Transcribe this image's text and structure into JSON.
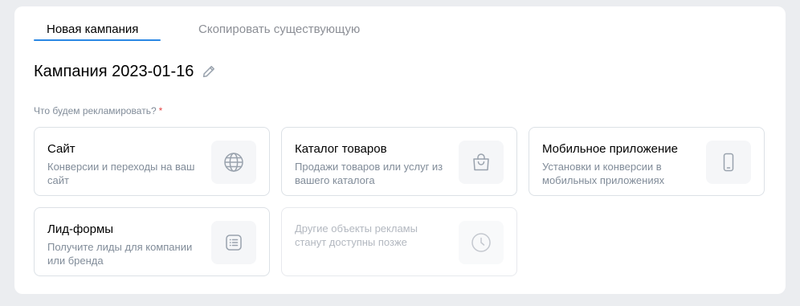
{
  "tabs": [
    {
      "label": "Новая кампания",
      "active": true
    },
    {
      "label": "Скопировать существующую",
      "active": false
    }
  ],
  "campaign": {
    "title": "Кампания 2023-01-16"
  },
  "question": {
    "label": "Что будем рекламировать?",
    "required_mark": "*"
  },
  "cards": [
    {
      "title": "Сайт",
      "description": "Конверсии и переходы на ваш сайт",
      "icon": "globe-icon"
    },
    {
      "title": "Каталог товаров",
      "description": "Продажи товаров или услуг из вашего каталога",
      "icon": "shopping-bag-icon"
    },
    {
      "title": "Мобильное приложение",
      "description": "Установки и конверсии в мобильных приложениях",
      "icon": "smartphone-icon"
    },
    {
      "title": "Лид-формы",
      "description": "Получите лиды для компании или бренда",
      "icon": "form-list-icon"
    },
    {
      "title": "",
      "description": "Другие объекты рекламы станут доступны позже",
      "icon": "clock-icon",
      "disabled": true
    }
  ],
  "colors": {
    "accent": "#2a88e4",
    "required": "#e64646",
    "secondary_text": "#818c99",
    "icon": "#99a2ad",
    "border": "#dce1e6",
    "background": "#ebedf0"
  }
}
